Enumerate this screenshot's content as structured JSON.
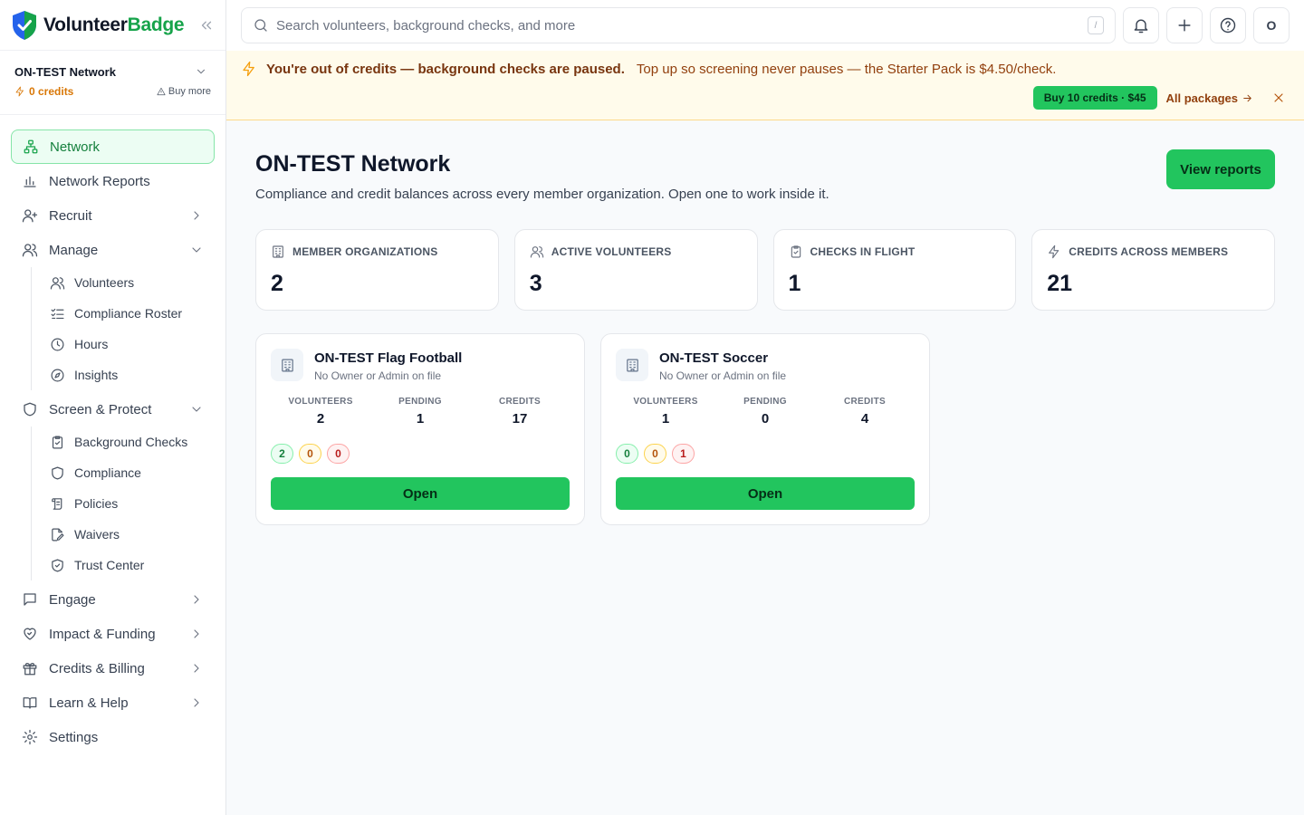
{
  "brand": {
    "name_a": "Volunteer",
    "name_b": "Badge"
  },
  "org_switcher": {
    "name": "ON-TEST Network",
    "credits": "0 credits",
    "buy_more": "Buy more"
  },
  "nav": {
    "network": "Network",
    "network_reports": "Network Reports",
    "recruit": "Recruit",
    "manage": "Manage",
    "manage_sub": [
      "Volunteers",
      "Compliance Roster",
      "Hours",
      "Insights"
    ],
    "screen": "Screen & Protect",
    "screen_sub": [
      "Background Checks",
      "Compliance",
      "Policies",
      "Waivers",
      "Trust Center"
    ],
    "engage": "Engage",
    "impact": "Impact & Funding",
    "credits": "Credits & Billing",
    "learn": "Learn & Help",
    "settings": "Settings"
  },
  "topbar": {
    "search_placeholder": "Search volunteers, background checks, and more",
    "shortcut": "/",
    "avatar": "O"
  },
  "banner": {
    "title": "You're out of credits — background checks are paused.",
    "message": "Top up so screening never pauses — the Starter Pack is $4.50/check.",
    "buy_label": "Buy 10 credits · $45",
    "packages_label": "All packages"
  },
  "page": {
    "title": "ON-TEST Network",
    "subtitle": "Compliance and credit balances across every member organization. Open one to work inside it.",
    "reports_button": "View reports"
  },
  "stats": [
    {
      "label": "MEMBER ORGANIZATIONS",
      "value": "2"
    },
    {
      "label": "ACTIVE VOLUNTEERS",
      "value": "3"
    },
    {
      "label": "CHECKS IN FLIGHT",
      "value": "1"
    },
    {
      "label": "CREDITS ACROSS MEMBERS",
      "value": "21"
    }
  ],
  "org_stat_labels": {
    "volunteers": "VOLUNTEERS",
    "pending": "PENDING",
    "credits": "CREDITS"
  },
  "orgs": [
    {
      "name": "ON-TEST Flag Football",
      "owner": "No Owner or Admin on file",
      "volunteers": "2",
      "pending": "1",
      "credits": "17",
      "chips": [
        "2",
        "0",
        "0"
      ],
      "open": "Open"
    },
    {
      "name": "ON-TEST Soccer",
      "owner": "No Owner or Admin on file",
      "volunteers": "1",
      "pending": "0",
      "credits": "4",
      "chips": [
        "0",
        "0",
        "1"
      ],
      "open": "Open"
    }
  ],
  "colors": {
    "accent": "#22c55e",
    "accent_dark": "#16a34a",
    "warning_bg": "#fffbeb",
    "warning": "#f59e0b"
  }
}
